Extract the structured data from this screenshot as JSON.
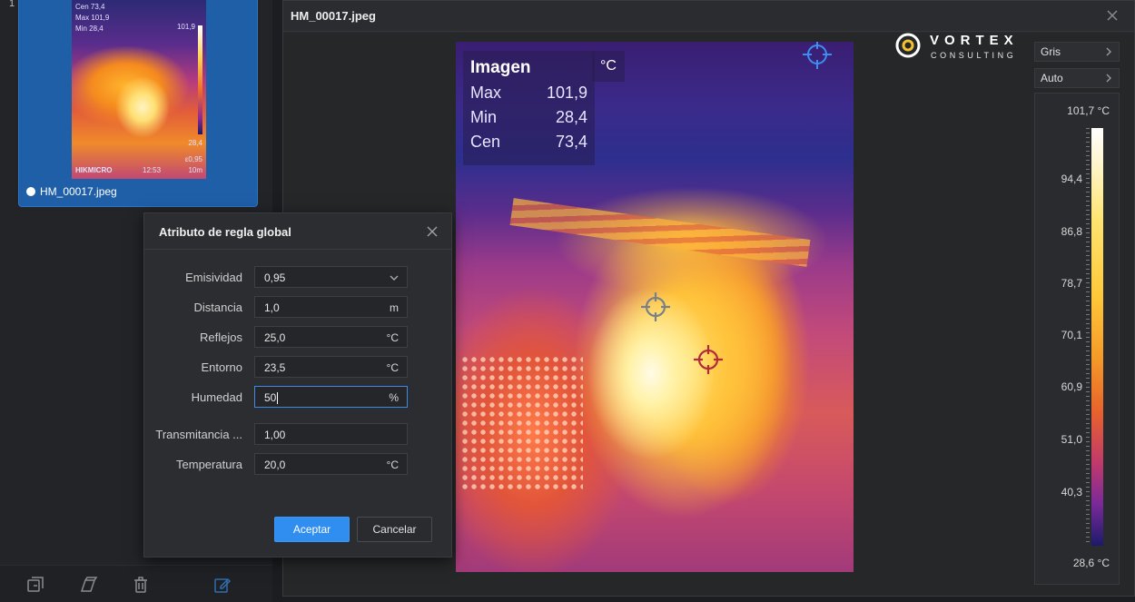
{
  "left_panel": {
    "index": "1",
    "thumbnail": {
      "filename": "HM_00017.jpeg",
      "overlay": [
        "Cen 73,4",
        "Max 101,9",
        "Min 28,4"
      ],
      "scale_top": "101,9",
      "scale_bottom": "28,4",
      "emissivity": "ε0,95",
      "distance": "10m",
      "time": "12:53",
      "brand": "HIKMICRO"
    },
    "toolbar": [
      "import-icon",
      "export-icon",
      "trash-icon",
      "edit-icon"
    ]
  },
  "viewer": {
    "title": "HM_00017.jpeg",
    "overlay": {
      "title": "Imagen",
      "unit": "°C",
      "rows": [
        {
          "label": "Max",
          "value": "101,9"
        },
        {
          "label": "Min",
          "value": "28,4"
        },
        {
          "label": "Cen",
          "value": "73,4"
        }
      ]
    },
    "palette_button": "Gris",
    "range_button": "Auto",
    "scale": {
      "max": "101,7 °C",
      "min": "28,6 °C",
      "ticks": [
        "94,4",
        "86,8",
        "78,7",
        "70,1",
        "60,9",
        "51,0",
        "40,3"
      ]
    }
  },
  "logo": {
    "name": "VORTEX",
    "sub": "CONSULTING"
  },
  "dialog": {
    "title": "Atributo de regla global",
    "fields": [
      {
        "label": "Emisividad",
        "value": "0,95",
        "unit": ""
      },
      {
        "label": "Distancia",
        "value": "1,0",
        "unit": "m"
      },
      {
        "label": "Reflejos",
        "value": "25,0",
        "unit": "°C"
      },
      {
        "label": "Entorno",
        "value": "23,5",
        "unit": "°C"
      },
      {
        "label": "Humedad",
        "value": "50",
        "unit": "%"
      },
      {
        "label": "Transmitancia ...",
        "value": "1,00",
        "unit": ""
      },
      {
        "label": "Temperatura",
        "value": "20,0",
        "unit": "°C"
      }
    ],
    "accept": "Aceptar",
    "cancel": "Cancelar"
  },
  "colors": {
    "accent": "#2f8ef0",
    "background": "#1c1d20"
  }
}
